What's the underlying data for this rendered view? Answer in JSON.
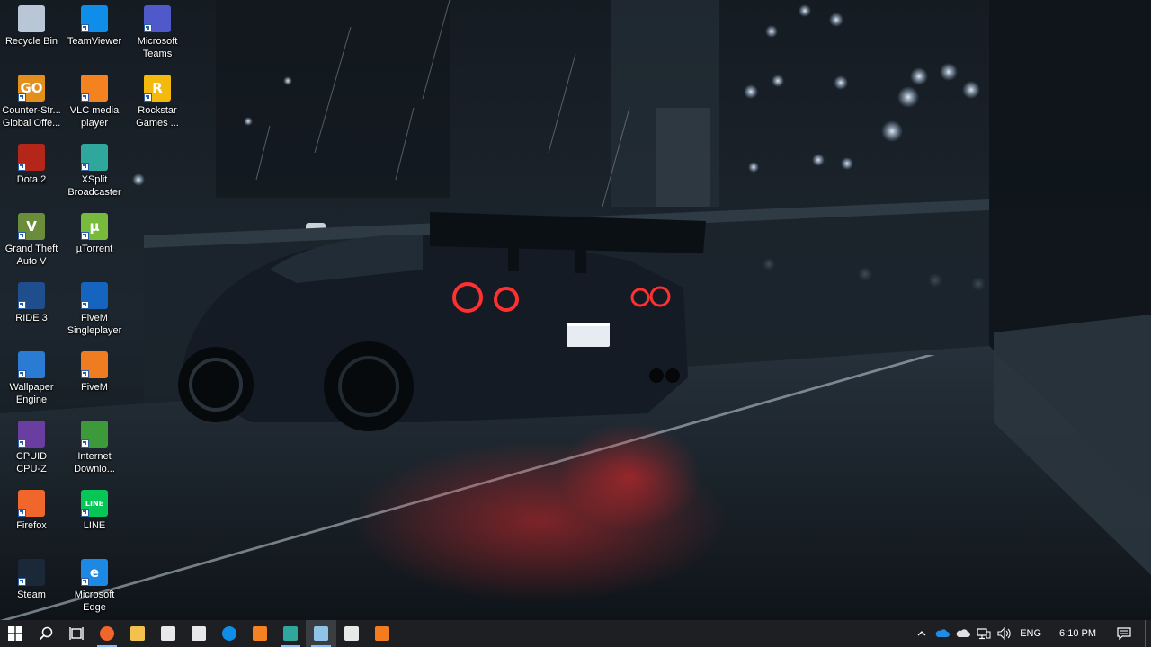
{
  "desktop": {
    "icons": [
      {
        "label": "Recycle Bin",
        "icon": "recycle-bin-icon",
        "color": "#b8c6d6"
      },
      {
        "label": "TeamViewer",
        "icon": "teamviewer-icon",
        "color": "#0e8ee9"
      },
      {
        "label": "Microsoft\nTeams",
        "icon": "teams-icon",
        "color": "#5059c9"
      },
      {
        "label": "Counter-Str...\nGlobal Offe...",
        "icon": "csgo-icon",
        "color": "#e28f1b",
        "glyph": "GO"
      },
      {
        "label": "VLC media\nplayer",
        "icon": "vlc-icon",
        "color": "#f58220"
      },
      {
        "label": "Rockstar\nGames ...",
        "icon": "rockstar-icon",
        "color": "#f3b90d",
        "glyph": "R"
      },
      {
        "label": "Dota 2",
        "icon": "dota2-icon",
        "color": "#b4261a"
      },
      {
        "label": "XSplit\nBroadcaster",
        "icon": "xsplit-icon",
        "color": "#2fa79c"
      },
      {
        "label": "Grand Theft\nAuto V",
        "icon": "gta5-icon",
        "color": "#6b8c3a",
        "glyph": "V"
      },
      {
        "label": "µTorrent",
        "icon": "utorrent-icon",
        "color": "#78bb3c",
        "glyph": "µ"
      },
      {
        "label": "RIDE 3",
        "icon": "ride3-icon",
        "color": "#1f4e8c"
      },
      {
        "label": "FiveM\nSingleplayer",
        "icon": "fivem-singleplayer-icon",
        "color": "#1565c0"
      },
      {
        "label": "Wallpaper\nEngine",
        "icon": "wallpaper-engine-icon",
        "color": "#2a7bd4"
      },
      {
        "label": "FiveM",
        "icon": "fivem-icon",
        "color": "#f07c21"
      },
      {
        "label": "CPUID\nCPU-Z",
        "icon": "cpuz-icon",
        "color": "#6a3ea1"
      },
      {
        "label": "Internet\nDownlo...",
        "icon": "idm-icon",
        "color": "#3d9a3a"
      },
      {
        "label": "Firefox",
        "icon": "firefox-icon",
        "color": "#f1662a"
      },
      {
        "label": "LINE",
        "icon": "line-icon",
        "color": "#06c755",
        "glyph": "LINE"
      },
      {
        "label": "Steam",
        "icon": "steam-icon",
        "color": "#1b2838"
      },
      {
        "label": "Microsoft\nEdge",
        "icon": "edge-icon",
        "color": "#1e88e5",
        "glyph": "e"
      }
    ]
  },
  "taskbar": {
    "pinned": [
      {
        "name": "firefox",
        "icon": "firefox-icon",
        "color": "#f1662a"
      },
      {
        "name": "file-explorer",
        "icon": "file-explorer-icon",
        "color": "#f2c14e"
      },
      {
        "name": "store",
        "icon": "store-icon",
        "color": "#e8e8e8"
      },
      {
        "name": "mail",
        "icon": "mail-icon",
        "color": "#e8e8e8"
      },
      {
        "name": "teamviewer",
        "icon": "teamviewer-icon",
        "color": "#0e8ee9"
      },
      {
        "name": "vlc",
        "icon": "vlc-icon",
        "color": "#f58220"
      },
      {
        "name": "xsplit",
        "icon": "xsplit-icon",
        "color": "#2fa79c"
      },
      {
        "name": "notepad",
        "icon": "notepad-icon",
        "color": "#8fc3e8"
      },
      {
        "name": "security",
        "icon": "shield-icon",
        "color": "#e8e8e8"
      },
      {
        "name": "xampp",
        "icon": "xampp-icon",
        "color": "#f37c20"
      }
    ],
    "tray": {
      "language": "ENG",
      "time": "6:10 PM"
    }
  }
}
